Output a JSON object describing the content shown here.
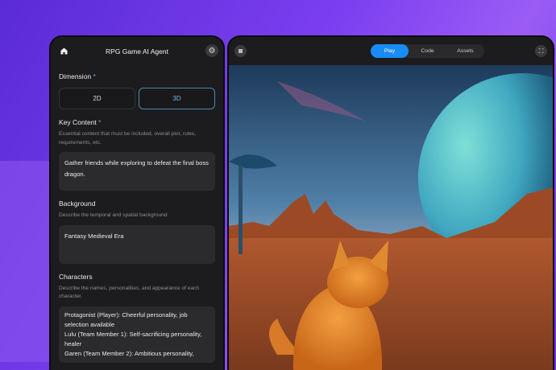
{
  "left_panel": {
    "title": "RPG Game AI Agent",
    "dimension": {
      "label": "Dimension",
      "required": "*",
      "options": [
        "2D",
        "3D"
      ],
      "selected": "3D"
    },
    "key_content": {
      "label": "Key Content",
      "required": "*",
      "description": "Essential content that must be included, overall plot, rules, requirements, etc.",
      "value": "Gather friends while exploring to defeat the final boss dragon."
    },
    "background": {
      "label": "Background",
      "description": "Describe the temporal and spatial background.",
      "value": "Fantasy Medieval Era"
    },
    "characters": {
      "label": "Characters",
      "description": "Describe the names, personalities, and appearance of each character.",
      "lines": [
        "Protagonist (Player): Cheerful personality, job selection available",
        "Lulu (Team Member 1): Self-sacrificing personality, healer",
        "Garen (Team Member 2): Ambitious personality,"
      ]
    }
  },
  "right_panel": {
    "tabs": [
      "Play",
      "Code",
      "Assets"
    ],
    "active_tab": "Play",
    "accent": "#1a8cf5"
  }
}
